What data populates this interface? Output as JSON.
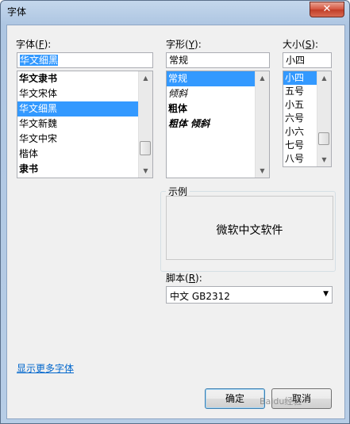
{
  "window": {
    "title": "字体",
    "close_glyph": "✕"
  },
  "font": {
    "label": "字体",
    "accel": "F",
    "value": "华文细黑",
    "items": [
      "华文隶书",
      "华文宋体",
      "华文细黑",
      "华文新魏",
      "华文中宋",
      "楷体",
      "隶书"
    ],
    "selected_index": 2
  },
  "style": {
    "label": "字形",
    "accel": "Y",
    "value": "常规",
    "items": [
      "常规",
      "倾斜",
      "粗体",
      "粗体 倾斜"
    ],
    "selected_index": 0
  },
  "size": {
    "label": "大小",
    "accel": "S",
    "value": "小四",
    "items": [
      "小四",
      "五号",
      "小五",
      "六号",
      "小六",
      "七号",
      "八号"
    ],
    "selected_index": 0
  },
  "sample": {
    "label": "示例",
    "text": "微软中文软件"
  },
  "script": {
    "label": "脚本",
    "accel": "R",
    "value": "中文 GB2312"
  },
  "more_fonts_link": "显示更多字体",
  "buttons": {
    "ok": "确定",
    "cancel": "取消"
  },
  "watermark": "Baidu经验"
}
